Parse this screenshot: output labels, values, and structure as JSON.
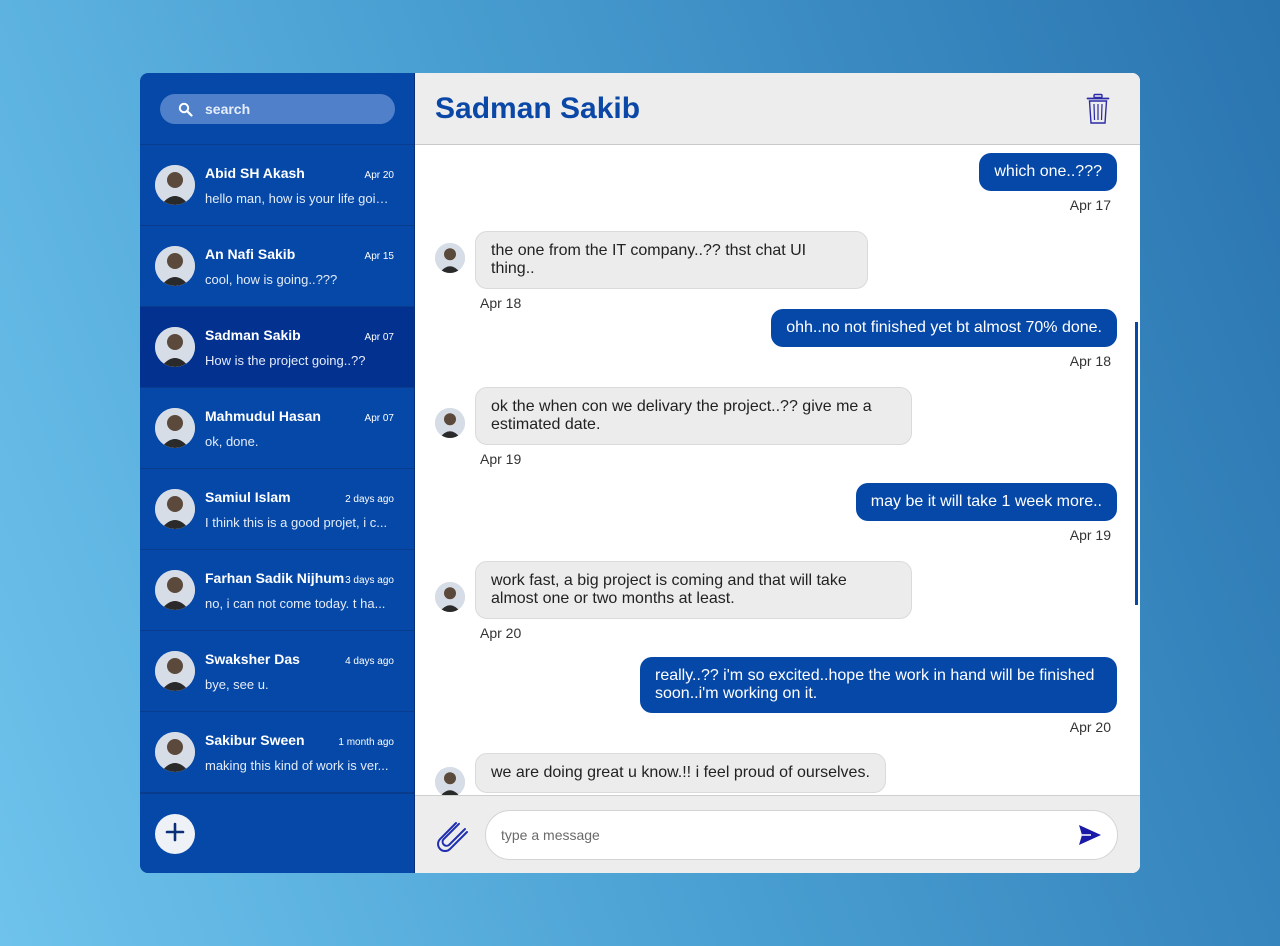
{
  "search": {
    "placeholder": "search",
    "icon": "search-icon"
  },
  "contacts": [
    {
      "name": "Abid SH Akash",
      "time": "Apr 20",
      "preview": "hello man, how is your life going...",
      "active": false
    },
    {
      "name": "An Nafi Sakib",
      "time": "Apr 15",
      "preview": "cool, how is going..???",
      "active": false
    },
    {
      "name": "Sadman Sakib",
      "time": "Apr 07",
      "preview": "How is the project going..??",
      "active": true
    },
    {
      "name": "Mahmudul Hasan",
      "time": "Apr 07",
      "preview": "ok, done.",
      "active": false
    },
    {
      "name": "Samiul Islam",
      "time": "2 days ago",
      "preview": "I think this is a good projet, i c...",
      "active": false
    },
    {
      "name": "Farhan Sadik Nijhum",
      "time": "3 days ago",
      "preview": "no, i can not come today. t ha...",
      "active": false
    },
    {
      "name": "Swaksher Das",
      "time": "4 days ago",
      "preview": "bye, see u.",
      "active": false
    },
    {
      "name": "Sakibur Sween",
      "time": "1 month ago",
      "preview": "making this kind of work is ver...",
      "active": false
    }
  ],
  "chat": {
    "title": "Sadman Sakib",
    "messages": [
      {
        "dir": "out",
        "text": "which one..???",
        "date": "Apr 17"
      },
      {
        "dir": "in",
        "text": "the one from the IT company..?? thst chat UI thing..",
        "date": "Apr 18"
      },
      {
        "dir": "out",
        "text": "ohh..no not finished yet bt almost 70% done.",
        "date": "Apr 18"
      },
      {
        "dir": "in",
        "text": "ok the when con we delivary the project..?? give me a estimated date.",
        "date": "Apr 19"
      },
      {
        "dir": "out",
        "text": "may be it will take 1 week more..",
        "date": "Apr 19"
      },
      {
        "dir": "in",
        "text": "work fast, a big project is coming and that will take almost one or two months at least.",
        "date": "Apr 20"
      },
      {
        "dir": "out",
        "text": "really..?? i'm so excited..hope the work in hand will be finished soon..i'm working on it.",
        "date": "Apr 20"
      },
      {
        "dir": "in",
        "text": "we are doing great u know.!! i feel proud of ourselves.",
        "date": ""
      }
    ]
  },
  "composer": {
    "placeholder": "type a message"
  },
  "colors": {
    "brand": "#0548a8",
    "active": "#033190",
    "header_bg": "#ededed",
    "title": "#0a47a6"
  },
  "icons": [
    "search-icon",
    "trash-icon",
    "add-icon",
    "paperclip-icon",
    "send-icon",
    "avatar"
  ]
}
